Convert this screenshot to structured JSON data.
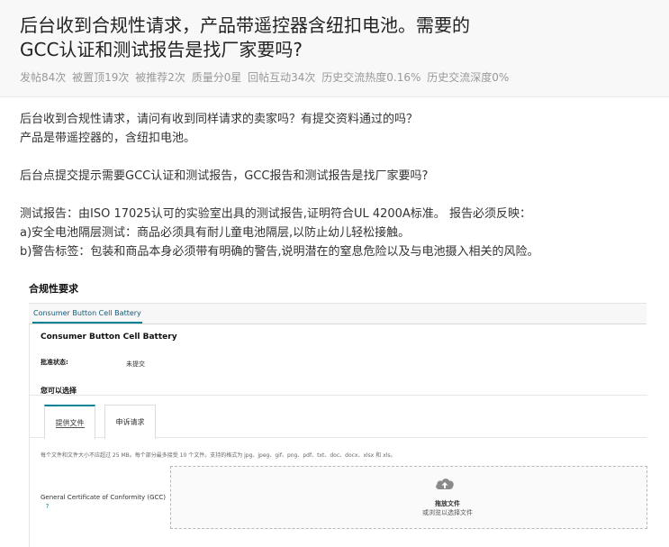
{
  "post": {
    "title_line1": "后台收到合规性请求，产品带遥控器含纽扣电池。需要的",
    "title_line2": "GCC认证和测试报告是找厂家要吗?",
    "stats": [
      "发帖84次",
      "被置顶19次",
      "被推荐2次",
      "质量分0星",
      "回帖互动34次",
      "历史交流热度0.16%",
      "历史交流深度0%"
    ]
  },
  "body": {
    "lines": [
      "后台收到合规性请求，请问有收到同样请求的卖家吗？有提交资料通过的吗？",
      "产品是带遥控器的，含纽扣电池。",
      "后台点提交提示需要GCC认证和测试报告，GCC报告和测试报告是找厂家要吗?",
      "测试报告：由ISO 17025认可的实验室出具的测试报告,证明符合UL 4200A标准。 报告必须反映：",
      "a)安全电池隔层测试：商品必须具有耐儿童电池隔层,以防止幼儿轻松接触。",
      "b)警告标签：包装和商品本身必须带有明确的警告,说明潜在的窒息危险以及与电池摄入相关的风险。"
    ]
  },
  "screenshot": {
    "heading": "合规性要求",
    "tab": "Consumer Button Cell Battery",
    "panel_title": "Consumer Button Cell Battery",
    "status_label": "批准状态:",
    "status_value": "未提交",
    "select_label": "您可以选择",
    "options": [
      "提供文件",
      "申诉请求"
    ],
    "file_note": "每个文件和文件大小不应超过 25 MB。每个部分最多接受 10 个文件。支持的格式为 jpg、jpeg、gif、png、pdf、txt、doc、docx、xlsx 和 xls。",
    "gcc_label": "General Certificate of Conformity (GCC)",
    "help_icon": "?",
    "drop_title": "拖放文件",
    "drop_sub": "或浏览以选择文件"
  },
  "colors": {
    "accent": "#008296",
    "header_bg": "#f8f8f8",
    "muted_text": "#999999"
  }
}
